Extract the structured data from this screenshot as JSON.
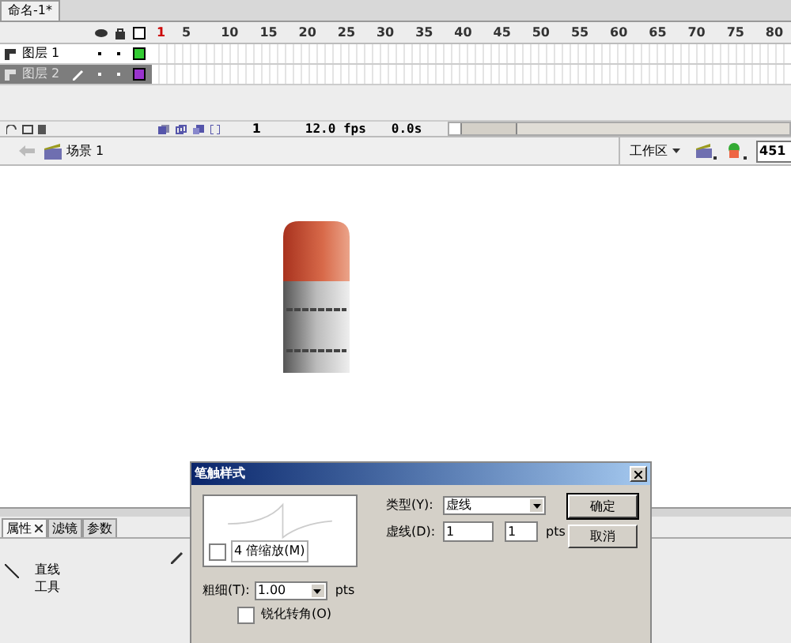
{
  "document_tab": {
    "label": "命名-1*"
  },
  "timeline": {
    "frame_numbers": [
      "1",
      "5",
      "10",
      "15",
      "20",
      "25",
      "30",
      "35",
      "40",
      "45",
      "50",
      "55",
      "60",
      "65",
      "70",
      "75",
      "80"
    ],
    "layers": [
      {
        "name": "图层 1",
        "selected": false,
        "editing": false,
        "color": "#33cc33"
      },
      {
        "name": "图层 2",
        "selected": true,
        "editing": true,
        "color": "#9933cc"
      }
    ],
    "current_frame": "1",
    "fps": "12.0 fps",
    "time": "0.0s"
  },
  "edit_bar": {
    "scene": "场景 1",
    "workspace": "工作区",
    "zoom": "451"
  },
  "properties_panel": {
    "tabs": [
      {
        "label": "属性",
        "selected": true,
        "closable": true
      },
      {
        "label": "滤镜",
        "selected": false,
        "closable": false
      },
      {
        "label": "参数",
        "selected": false,
        "closable": false
      }
    ],
    "tool_name": [
      "直线",
      "工具"
    ]
  },
  "dialog": {
    "title": "笔触样式",
    "zoom_checkbox": {
      "label": "4 倍缩放(M)",
      "checked": false
    },
    "type_label": "类型(Y):",
    "type_value": "虚线",
    "dash_label": "虚线(D):",
    "dash_values": [
      "1",
      "1"
    ],
    "dash_unit": "pts",
    "buttons": [
      "确定",
      "取消"
    ],
    "thickness_label": "粗细(T):",
    "thickness_value": "1.00",
    "thickness_unit": "pts",
    "sharp_corners": {
      "label": "锐化转角(O)",
      "checked": false
    }
  }
}
